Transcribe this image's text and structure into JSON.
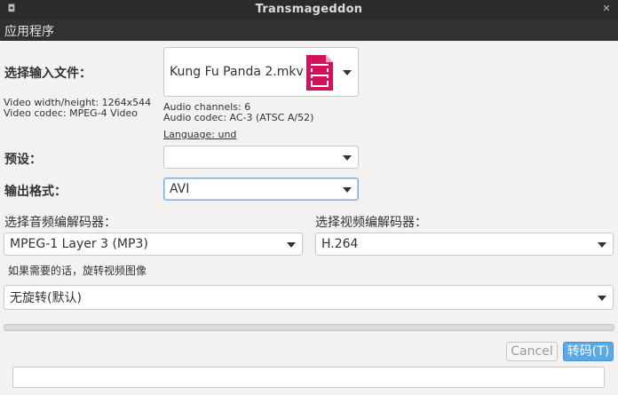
{
  "window": {
    "title": "Transmageddon"
  },
  "menubar": {
    "app_menu": "应用程序"
  },
  "input": {
    "label": "选择输入文件：",
    "file": "Kung Fu Panda 2.mkv",
    "video_info": [
      "Video width/height: 1264x544",
      "Video codec: MPEG-4 Video"
    ],
    "audio_info": [
      "Audio channels: 6",
      "Audio codec: AC-3 (ATSC A/52)"
    ],
    "language": "Language: und"
  },
  "preset": {
    "label": "预设：",
    "value": ""
  },
  "output_format": {
    "label": "输出格式：",
    "value": "AVI"
  },
  "audio_codec": {
    "label": "选择音频编解码器：",
    "value": "MPEG-1 Layer 3 (MP3)"
  },
  "video_codec": {
    "label": "选择视频编解码器：",
    "value": "H.264"
  },
  "rotation": {
    "label": "如果需要的话，旋转视频图像",
    "value": "无旋转(默认)"
  },
  "buttons": {
    "cancel": "Cancel",
    "convert": "转码(T)"
  },
  "progress": {
    "fraction": 0
  },
  "colors": {
    "accent": "#5aa9e6",
    "file_icon": "#d1145a",
    "titlebar": "#2b2b2b"
  }
}
